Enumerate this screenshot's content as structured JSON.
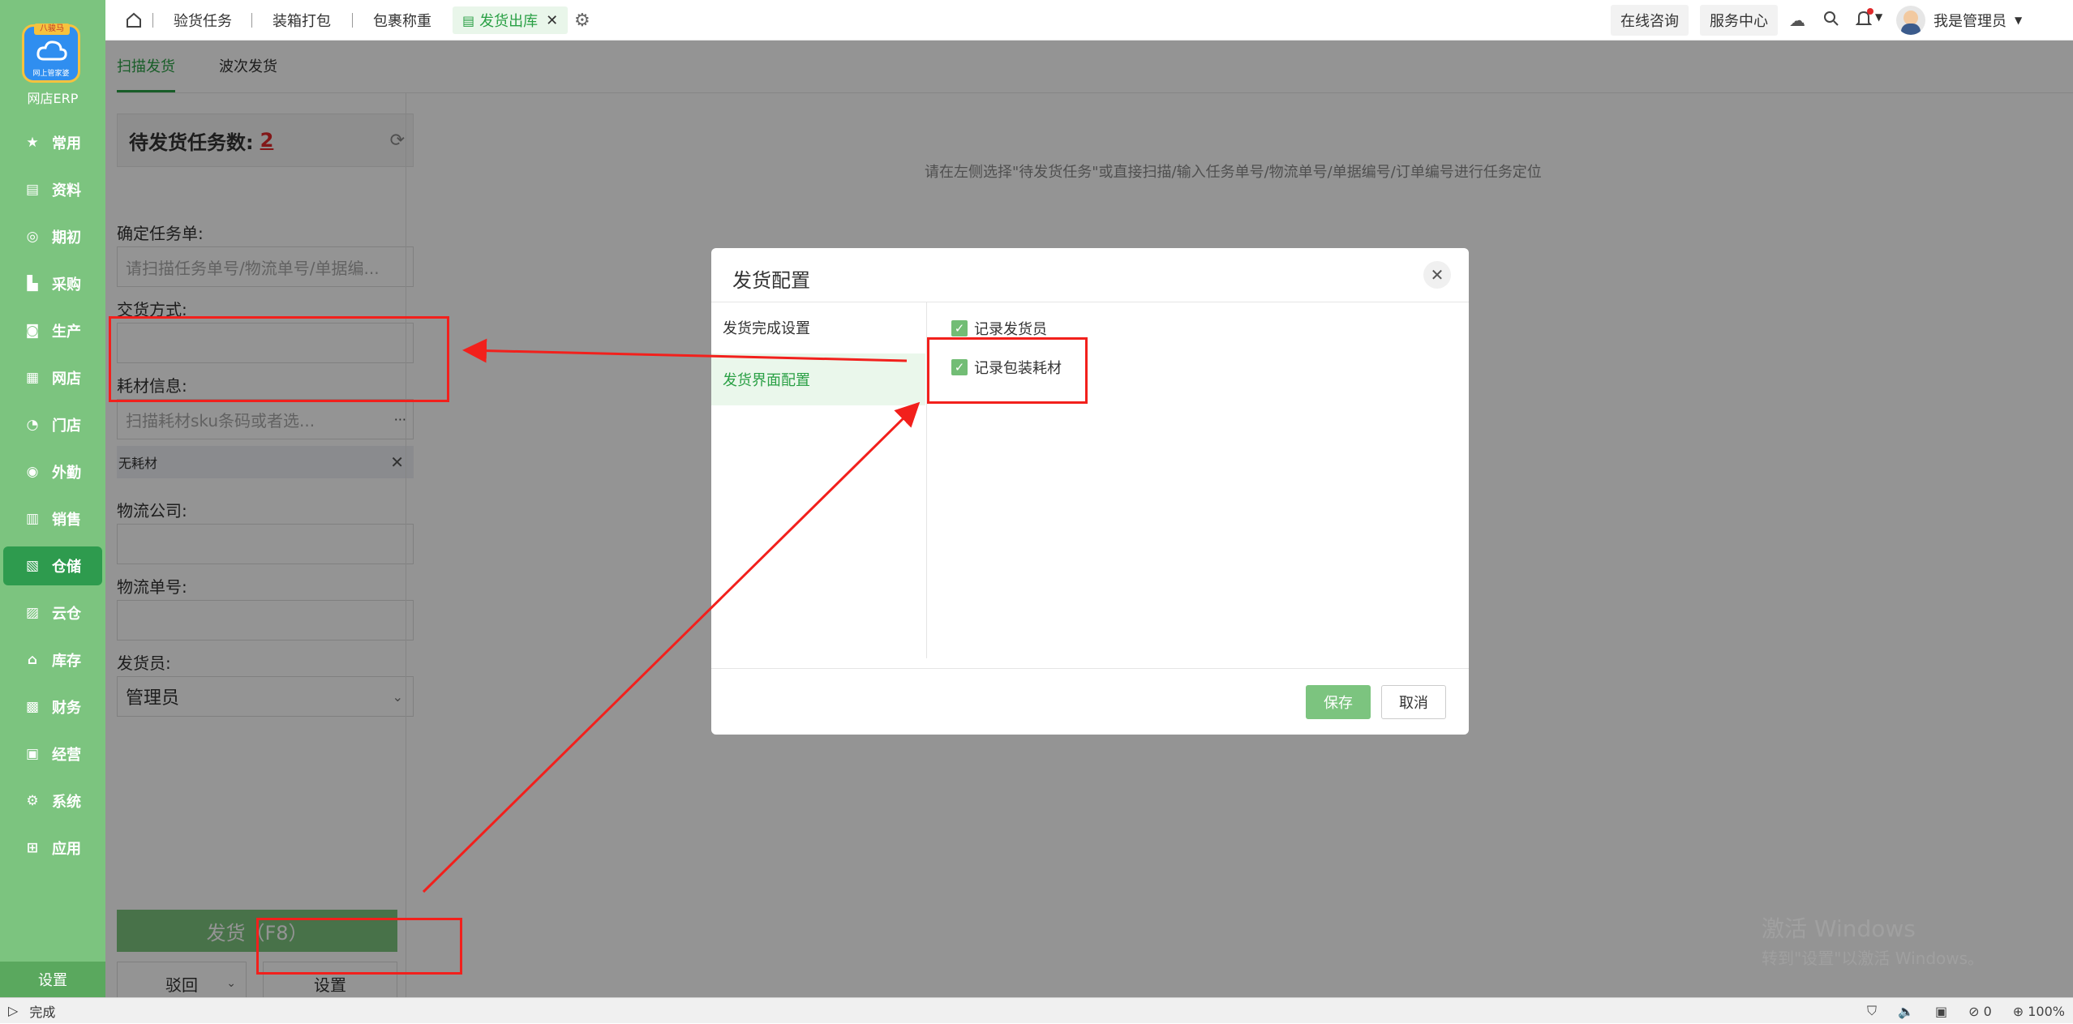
{
  "app": {
    "logo_text": "网店ERP",
    "logo_badge": "八骏马",
    "logo_sub": "网上管家婆"
  },
  "sidebar": {
    "items": [
      {
        "label": "常用",
        "icon": "star-icon"
      },
      {
        "label": "资料",
        "icon": "document-icon"
      },
      {
        "label": "期初",
        "icon": "clock-icon"
      },
      {
        "label": "采购",
        "icon": "cart-icon"
      },
      {
        "label": "生产",
        "icon": "factory-icon"
      },
      {
        "label": "网店",
        "icon": "store-icon"
      },
      {
        "label": "门店",
        "icon": "pie-icon"
      },
      {
        "label": "外勤",
        "icon": "target-icon"
      },
      {
        "label": "销售",
        "icon": "chart-icon"
      },
      {
        "label": "仓储",
        "icon": "warehouse-icon"
      },
      {
        "label": "云仓",
        "icon": "cloud-warehouse-icon"
      },
      {
        "label": "库存",
        "icon": "home-icon"
      },
      {
        "label": "财务",
        "icon": "finance-icon"
      },
      {
        "label": "经营",
        "icon": "picture-icon"
      },
      {
        "label": "系统",
        "icon": "gear-icon"
      },
      {
        "label": "应用",
        "icon": "plus-icon"
      }
    ],
    "active": "仓储",
    "settings_label": "设置"
  },
  "topbar": {
    "tabs": [
      "验货任务",
      "装箱打包",
      "包裹称重",
      "发货出库"
    ],
    "active_tab": "发货出库",
    "online_consult": "在线咨询",
    "service_center": "服务中心",
    "user_name": "我是管理员"
  },
  "subtabs": [
    "扫描发货",
    "波次发货"
  ],
  "left_panel": {
    "pending_label": "待发货任务数:",
    "pending_count": "2",
    "confirm_task_label": "确定任务单:",
    "confirm_task_placeholder": "请扫描任务单号/物流单号/单据编...",
    "delivery_method_label": "交货方式:",
    "material_label": "耗材信息:",
    "material_placeholder": "扫描耗材sku条码或者选...",
    "material_more": "···",
    "no_material_tag": "无耗材",
    "logistics_company_label": "物流公司:",
    "logistics_no_label": "物流单号:",
    "shipper_label": "发货员:",
    "shipper_value": "管理员",
    "ship_button": "发货（F8）",
    "reject_button": "驳回",
    "settings_button": "设置"
  },
  "main_hint": "请在左侧选择\"待发货任务\"或直接扫描/输入任务单号/物流单号/单据编号/订单编号进行任务定位",
  "dialog": {
    "title": "发货配置",
    "nav": [
      "发货完成设置",
      "发货界面配置"
    ],
    "active_nav": "发货界面配置",
    "options": [
      {
        "label": "记录发货员",
        "checked": true
      },
      {
        "label": "记录包装耗材",
        "checked": true
      }
    ],
    "save": "保存",
    "cancel": "取消"
  },
  "watermark": {
    "line1": "激活 Windows",
    "line2": "转到\"设置\"以激活 Windows。"
  },
  "statusbar": {
    "text": "完成",
    "count": "0",
    "zoom": "100%"
  },
  "colors": {
    "brand_green": "#7cc47f",
    "active_green": "#2e9b4e",
    "accent_text": "#2aa045",
    "annotation_red": "#f2201c",
    "badge_red": "#e0282a"
  }
}
